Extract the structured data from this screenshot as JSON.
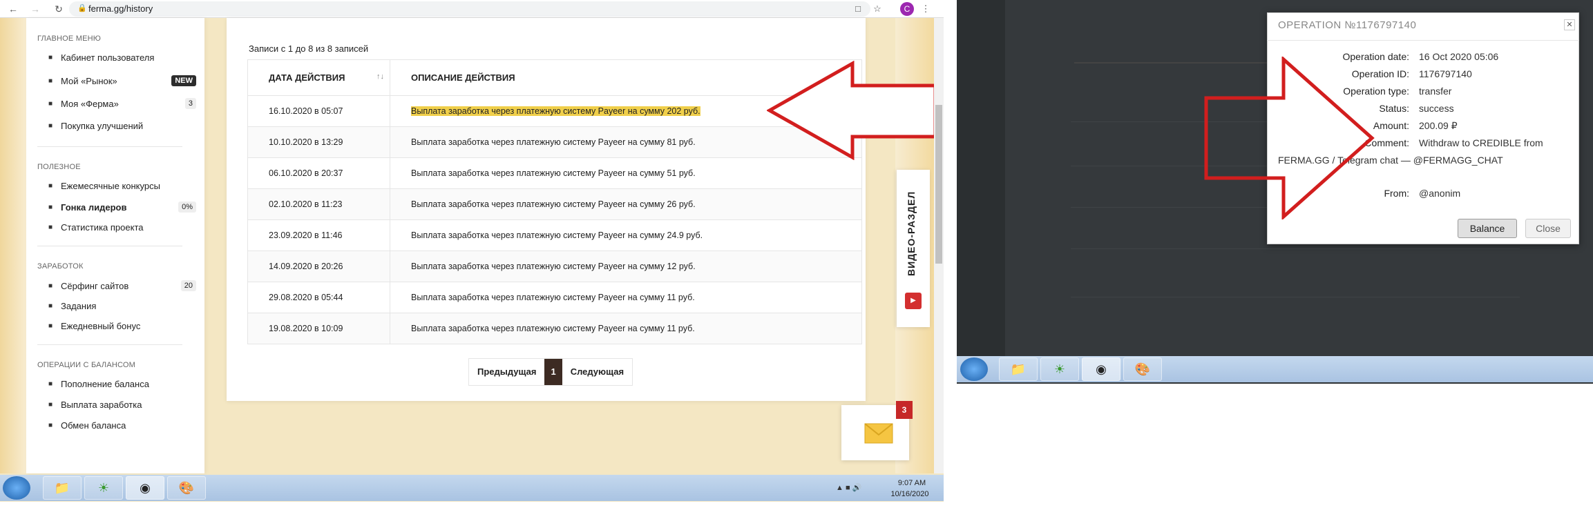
{
  "browser": {
    "url": "ferma.gg/history",
    "avatar_letter": "C"
  },
  "sidebar": {
    "sections": [
      {
        "title": "ГЛАВНОЕ МЕНЮ",
        "items": [
          {
            "icon": "dashboard-icon",
            "label": "Кабинет пользователя",
            "badge": ""
          },
          {
            "icon": "store-icon",
            "label": "Мой «Рынок»",
            "badge": "NEW"
          },
          {
            "icon": "farm-icon",
            "label": "Моя «Ферма»",
            "badge": "3"
          },
          {
            "icon": "cart-icon",
            "label": "Покупка улучшений",
            "badge": ""
          }
        ]
      },
      {
        "title": "ПОЛЕЗНОЕ",
        "items": [
          {
            "icon": "trophy-icon",
            "label": "Ежемесячные конкурсы",
            "badge": ""
          },
          {
            "icon": "flag-icon",
            "label": "Гонка лидеров",
            "badge": "0%"
          },
          {
            "icon": "chart-icon",
            "label": "Статистика проекта",
            "badge": ""
          }
        ]
      },
      {
        "title": "ЗАРАБОТОК",
        "items": [
          {
            "icon": "globe-icon",
            "label": "Сёрфинг сайтов",
            "badge": "20"
          },
          {
            "icon": "task-icon",
            "label": "Задания",
            "badge": ""
          },
          {
            "icon": "gift-icon",
            "label": "Ежедневный бонус",
            "badge": ""
          }
        ]
      },
      {
        "title": "ОПЕРАЦИИ С БАЛАНСОМ",
        "items": [
          {
            "icon": "deposit-icon",
            "label": "Пополнение баланса",
            "badge": ""
          },
          {
            "icon": "withdraw-icon",
            "label": "Выплата заработка",
            "badge": ""
          },
          {
            "icon": "exchange-icon",
            "label": "Обмен баланса",
            "badge": ""
          }
        ]
      }
    ]
  },
  "history": {
    "records_info": "Записи с 1 до 8 из 8 записей",
    "columns": [
      "ДАТА ДЕЙСТВИЯ",
      "ОПИСАНИЕ ДЕЙСТВИЯ"
    ],
    "rows": [
      {
        "date": "16.10.2020 в 05:07",
        "desc": "Выплата заработка через платежную систему Payeer на сумму 202 руб."
      },
      {
        "date": "10.10.2020 в 13:29",
        "desc": "Выплата заработка через платежную систему Payeer на сумму 81 руб."
      },
      {
        "date": "06.10.2020 в 20:37",
        "desc": "Выплата заработка через платежную систему Payeer на сумму 51 руб."
      },
      {
        "date": "02.10.2020 в 11:23",
        "desc": "Выплата заработка через платежную систему Payeer на сумму 26 руб."
      },
      {
        "date": "23.09.2020 в 11:46",
        "desc": "Выплата заработка через платежную систему Payeer на сумму 24.9 руб."
      },
      {
        "date": "14.09.2020 в 20:26",
        "desc": "Выплата заработка через платежную систему Payeer на сумму 12 руб."
      },
      {
        "date": "29.08.2020 в 05:44",
        "desc": "Выплата заработка через платежную систему Payeer на сумму 11 руб."
      },
      {
        "date": "19.08.2020 в 10:09",
        "desc": "Выплата заработка через платежную систему Payeer на сумму 11 руб."
      }
    ],
    "pager": {
      "prev": "Предыдущая",
      "page": "1",
      "next": "Следующая"
    }
  },
  "video_tab": "ВИДЕО-РАЗДЕЛ",
  "mail_badge": "3",
  "taskbar_left": {
    "time": "9:07 AM",
    "date": "10/16/2020"
  },
  "modal": {
    "title": "OPERATION №1176797140",
    "fields": [
      {
        "k": "Operation date:",
        "v": "16 Oct 2020 05:06"
      },
      {
        "k": "Operation ID:",
        "v": "1176797140"
      },
      {
        "k": "Operation type:",
        "v": "transfer"
      },
      {
        "k": "Status:",
        "v": "success"
      },
      {
        "k": "Amount:",
        "v": "200.09 ₽"
      },
      {
        "k": "Comment:",
        "v": "Withdraw to CREDIBLE from"
      }
    ],
    "comment_line2": "FERMA.GG / Telegram chat — @FERMAGG_CHAT",
    "from_k": "From:",
    "from_v": "@anonim",
    "balance_btn": "Balance",
    "close_btn": "Close"
  }
}
